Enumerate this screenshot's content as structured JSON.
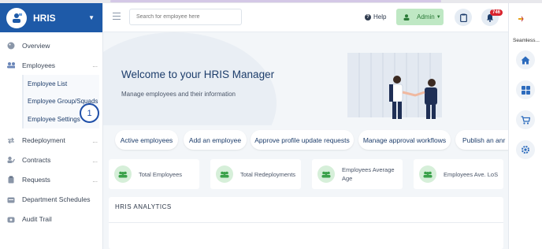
{
  "sidebar": {
    "brand": "HRIS",
    "items": [
      {
        "label": "Overview",
        "icon": "palette-icon"
      },
      {
        "label": "Employees",
        "icon": "users-icon",
        "has_more": "..."
      },
      {
        "label": "Redeployment",
        "icon": "arrows-icon",
        "has_more": "..."
      },
      {
        "label": "Contracts",
        "icon": "contract-icon",
        "has_more": "..."
      },
      {
        "label": "Requests",
        "icon": "clipboard-icon",
        "has_more": "..."
      },
      {
        "label": "Department Schedules",
        "icon": "calendar-icon"
      },
      {
        "label": "Audit Trail",
        "icon": "audit-icon"
      }
    ],
    "employees_submenu": [
      "Employee List",
      "Employee Group/Squads",
      "Employee Settings"
    ],
    "step_marker": "1"
  },
  "header": {
    "search_placeholder": "Search for employee here",
    "help_label": "Help",
    "admin_label": "Admin",
    "notification_count": "746"
  },
  "right_rail": {
    "app_label": "Seamless...",
    "buttons": [
      "home-icon",
      "grid-icon",
      "cart-icon",
      "settings-icon"
    ]
  },
  "hero": {
    "title": "Welcome to your HRIS Manager",
    "subtitle": "Manage employees and their information"
  },
  "quick_actions": [
    "Active employees",
    "Add an employee",
    "Approve profile update requests",
    "Manage approval workflows",
    "Publish an anr"
  ],
  "stats": [
    {
      "label": "Total Employees"
    },
    {
      "label": "Total Redeployments"
    },
    {
      "label": "Employees Average Age"
    },
    {
      "label": "Employees Ave. LoS"
    }
  ],
  "analytics": {
    "title": "HRIS ANALYTICS"
  },
  "colors": {
    "brand": "#1e5aa8",
    "admin_bg": "#bfe8c4",
    "badge": "#d9232d",
    "stat_icon": "#3aa14a"
  }
}
